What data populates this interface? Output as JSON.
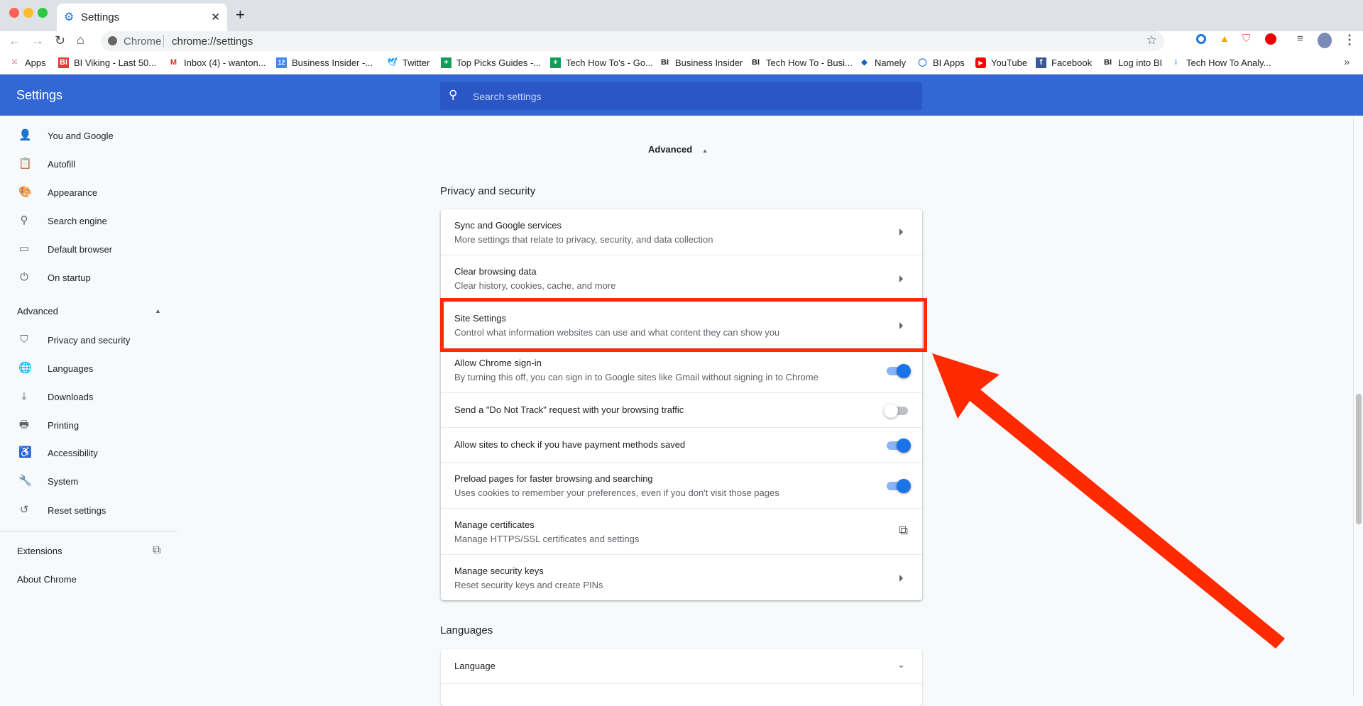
{
  "browser": {
    "tab_title": "Settings",
    "omnibox_chip": "Chrome",
    "url": "chrome://settings"
  },
  "bookmarks": [
    {
      "label": "Apps",
      "icon": "apps-grid-icon"
    },
    {
      "label": "BI Viking - Last 50...",
      "icon": "bi-icon"
    },
    {
      "label": "Inbox (4) - wanton...",
      "icon": "gmail-icon"
    },
    {
      "label": "Business Insider -...",
      "icon": "calendar-icon"
    },
    {
      "label": "Twitter",
      "icon": "twitter-icon"
    },
    {
      "label": "Top Picks Guides -...",
      "icon": "sheets-icon"
    },
    {
      "label": "Tech How To's - Go...",
      "icon": "sheets-icon"
    },
    {
      "label": "Business Insider",
      "icon": "bi-icon"
    },
    {
      "label": "Tech How To - Busi...",
      "icon": "bi-icon"
    },
    {
      "label": "Namely",
      "icon": "namely-icon"
    },
    {
      "label": "BI Apps",
      "icon": "ring-icon"
    },
    {
      "label": "YouTube",
      "icon": "youtube-icon"
    },
    {
      "label": "Facebook",
      "icon": "facebook-icon"
    },
    {
      "label": "Log into BI",
      "icon": "bi-icon"
    },
    {
      "label": "Tech How To Analy...",
      "icon": "analytics-icon"
    }
  ],
  "header": {
    "title": "Settings",
    "search_placeholder": "Search settings"
  },
  "sidebar": {
    "items": [
      {
        "label": "You and Google",
        "icon": "person-icon"
      },
      {
        "label": "Autofill",
        "icon": "clipboard-icon"
      },
      {
        "label": "Appearance",
        "icon": "palette-icon"
      },
      {
        "label": "Search engine",
        "icon": "search-icon"
      },
      {
        "label": "Default browser",
        "icon": "browser-icon"
      },
      {
        "label": "On startup",
        "icon": "power-icon"
      }
    ],
    "advanced_label": "Advanced",
    "advanced_items": [
      {
        "label": "Privacy and security",
        "icon": "shield-icon"
      },
      {
        "label": "Languages",
        "icon": "globe-icon"
      },
      {
        "label": "Downloads",
        "icon": "download-icon"
      },
      {
        "label": "Printing",
        "icon": "printer-icon"
      },
      {
        "label": "Accessibility",
        "icon": "accessibility-icon"
      },
      {
        "label": "System",
        "icon": "wrench-icon"
      },
      {
        "label": "Reset settings",
        "icon": "restore-icon"
      }
    ],
    "extensions": "Extensions",
    "about": "About Chrome"
  },
  "main": {
    "advanced_toggle": "Advanced",
    "privacy_heading": "Privacy and security",
    "rows": [
      {
        "title": "Sync and Google services",
        "sub": "More settings that relate to privacy, security, and data collection",
        "control": "arrow"
      },
      {
        "title": "Clear browsing data",
        "sub": "Clear history, cookies, cache, and more",
        "control": "arrow"
      },
      {
        "title": "Site Settings",
        "sub": "Control what information websites can use and what content they can show you",
        "control": "arrow",
        "highlighted": true
      },
      {
        "title": "Allow Chrome sign-in",
        "sub": "By turning this off, you can sign in to Google sites like Gmail without signing in to Chrome",
        "control": "toggle",
        "on": true
      },
      {
        "title": "Send a \"Do Not Track\" request with your browsing traffic",
        "control": "toggle",
        "on": false
      },
      {
        "title": "Allow sites to check if you have payment methods saved",
        "control": "toggle",
        "on": true
      },
      {
        "title": "Preload pages for faster browsing and searching",
        "sub": "Uses cookies to remember your preferences, even if you don't visit those pages",
        "control": "toggle",
        "on": true
      },
      {
        "title": "Manage certificates",
        "sub": "Manage HTTPS/SSL certificates and settings",
        "control": "external"
      },
      {
        "title": "Manage security keys",
        "sub": "Reset security keys and create PINs",
        "control": "arrow"
      }
    ],
    "languages_heading": "Languages",
    "language_row": "Language"
  },
  "colors": {
    "header": "#3367d6",
    "annotation": "#ff2a00",
    "toggle_on": "#1a73e8"
  }
}
